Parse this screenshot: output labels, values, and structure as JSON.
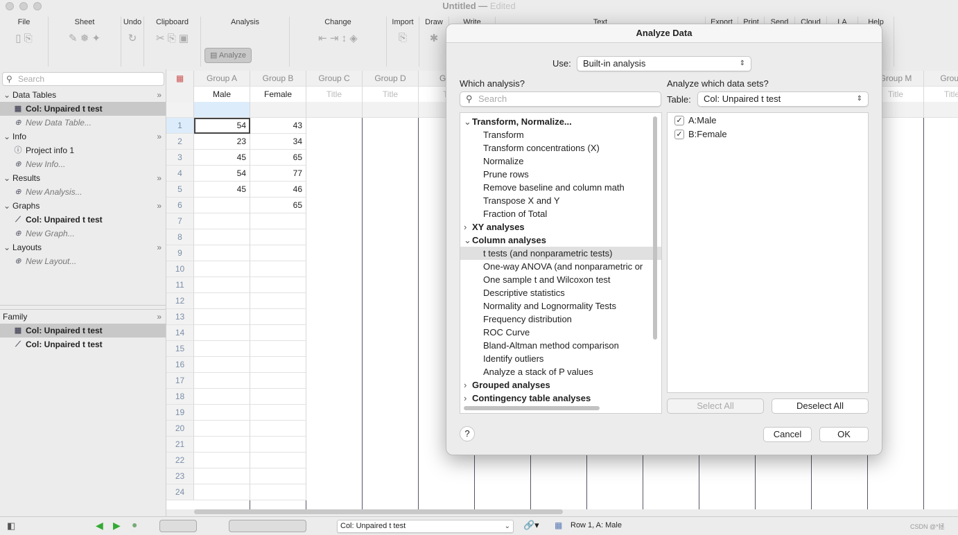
{
  "window": {
    "title": "Untitled",
    "status": "Edited"
  },
  "toolbar": {
    "groups": [
      "File",
      "Sheet",
      "Undo",
      "Clipboard",
      "Analysis",
      "Change",
      "Import",
      "Draw",
      "Write",
      "Text",
      "Export",
      "Print",
      "Send",
      "Cloud",
      "LA",
      "Help"
    ],
    "analyze_label": "Analyze"
  },
  "sidebar": {
    "search_placeholder": "Search",
    "sections": [
      {
        "label": "Data Tables",
        "items": [
          {
            "label": "Col: Unpaired t test",
            "selected": true,
            "icon": "table-icon"
          },
          {
            "label": "New Data Table...",
            "new": true
          }
        ]
      },
      {
        "label": "Info",
        "items": [
          {
            "label": "Project info 1",
            "icon": "info-icon"
          },
          {
            "label": "New Info...",
            "new": true
          }
        ]
      },
      {
        "label": "Results",
        "items": [
          {
            "label": "New Analysis...",
            "new": true
          }
        ]
      },
      {
        "label": "Graphs",
        "items": [
          {
            "label": "Col: Unpaired t test",
            "bold": true,
            "icon": "graph-icon"
          },
          {
            "label": "New Graph...",
            "new": true
          }
        ]
      },
      {
        "label": "Layouts",
        "items": [
          {
            "label": "New Layout...",
            "new": true
          }
        ]
      }
    ],
    "family": {
      "label": "Family",
      "items": [
        {
          "label": "Col: Unpaired t test",
          "icon": "table-icon"
        },
        {
          "label": "Col: Unpaired t test",
          "icon": "graph-icon"
        }
      ]
    }
  },
  "sheet": {
    "columns": [
      {
        "group": "Group A",
        "title": "Male"
      },
      {
        "group": "Group B",
        "title": "Female"
      },
      {
        "group": "Group C",
        "title": "Title"
      },
      {
        "group": "Group D",
        "title": "Title"
      },
      {
        "group": "Gro",
        "title": "Ti"
      },
      {
        "group": "",
        "title": ""
      },
      {
        "group": "",
        "title": ""
      },
      {
        "group": "",
        "title": ""
      },
      {
        "group": "",
        "title": ""
      },
      {
        "group": "",
        "title": ""
      },
      {
        "group": "",
        "title": ""
      },
      {
        "group": "",
        "title": ""
      },
      {
        "group": "Group M",
        "title": "Title"
      },
      {
        "group": "Group",
        "title": "Title"
      }
    ],
    "rows": [
      [
        "54",
        "43"
      ],
      [
        "23",
        "34"
      ],
      [
        "45",
        "65"
      ],
      [
        "54",
        "77"
      ],
      [
        "45",
        "46"
      ],
      [
        "",
        "65"
      ]
    ],
    "row_count": 24
  },
  "dialog": {
    "title": "Analyze Data",
    "use_label": "Use:",
    "use_value": "Built-in analysis",
    "which_label": "Which analysis?",
    "search_placeholder": "Search",
    "datasets_label": "Analyze which data sets?",
    "table_label": "Table:",
    "table_value": "Col: Unpaired t test",
    "tree": [
      {
        "label": "Transform, Normalize...",
        "cat": true,
        "open": true
      },
      {
        "label": "Transform"
      },
      {
        "label": "Transform concentrations (X)"
      },
      {
        "label": "Normalize"
      },
      {
        "label": "Prune rows"
      },
      {
        "label": "Remove baseline and column math"
      },
      {
        "label": "Transpose X and Y"
      },
      {
        "label": "Fraction of Total"
      },
      {
        "label": "XY analyses",
        "cat": true,
        "open": false
      },
      {
        "label": "Column analyses",
        "cat": true,
        "open": true
      },
      {
        "label": "t tests (and nonparametric tests)",
        "selected": true
      },
      {
        "label": "One-way ANOVA (and nonparametric or"
      },
      {
        "label": "One sample t and Wilcoxon test"
      },
      {
        "label": "Descriptive statistics"
      },
      {
        "label": "Normality and Lognormality Tests"
      },
      {
        "label": "Frequency distribution"
      },
      {
        "label": "ROC Curve"
      },
      {
        "label": "Bland-Altman method comparison"
      },
      {
        "label": "Identify outliers"
      },
      {
        "label": "Analyze a stack of P values"
      },
      {
        "label": "Grouped analyses",
        "cat": true,
        "open": false
      },
      {
        "label": "Contingency table analyses",
        "cat": true,
        "open": false
      }
    ],
    "datasets": [
      {
        "label": "A:Male",
        "checked": true
      },
      {
        "label": "B:Female",
        "checked": true
      }
    ],
    "select_all": "Select All",
    "deselect_all": "Deselect All",
    "help": "?",
    "cancel": "Cancel",
    "ok": "OK"
  },
  "statusbar": {
    "sheet_select": "Col: Unpaired t test",
    "position": "Row 1, A: Male",
    "watermark": "CSDN @*拯"
  }
}
